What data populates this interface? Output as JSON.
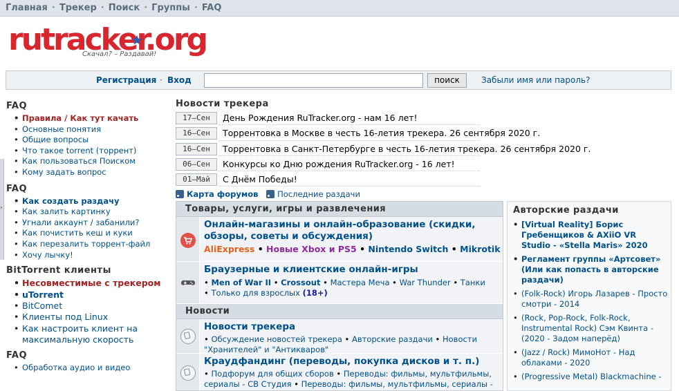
{
  "topnav": {
    "items": [
      "Главная",
      "Трекер",
      "Поиск",
      "Группы",
      "FAQ"
    ]
  },
  "logo": {
    "name": "rutracker.org",
    "slogan": "Скачал? – Раздавай!"
  },
  "login": {
    "register": "Регистрация",
    "login": "Вход",
    "search_value": "",
    "search_button": "поиск",
    "forgot": "Забыли имя или пароль?"
  },
  "left": {
    "sec1": {
      "title": "FAQ",
      "items": [
        "Правила",
        "Как тут качать",
        "Основные понятия",
        "Общие вопросы",
        "Что такое torrent (торрент)",
        "Как пользоваться Поиском",
        "Кому задать вопрос"
      ]
    },
    "sec2": {
      "title": "FAQ",
      "items": [
        "Как создать раздачу",
        "Как залить картинку",
        "Угнали аккаунт / забанили?",
        "Как почистить кеш и куки",
        "Как перезалить торрент-файл",
        "Хочу лычку!"
      ]
    },
    "sec3": {
      "title": "BitTorrent клиенты",
      "items": [
        "Несовместимые с трекером",
        "uTorrent",
        "BitComet",
        "Клиенты под Linux",
        "Как настроить клиент на максимальную скорость"
      ]
    },
    "sec4": {
      "title": "FAQ",
      "items": [
        "Обработка аудио и видео"
      ]
    }
  },
  "news": {
    "title": "Новости трекера",
    "items": [
      {
        "date": "17–Сен",
        "text": "День Рождения RuTracker.org - нам 16 лет!"
      },
      {
        "date": "16–Сен",
        "text": "Торрентовка в Москве в честь 16-летия трекера. 26 сентября 2020 г."
      },
      {
        "date": "16–Сен",
        "text": "Торрентовка в Санкт-Петербурге в честь 16-летия трекера. 26 сентября 2020 г."
      },
      {
        "date": "06–Сен",
        "text": "Конкурсы ко Дню рождения RuTracker.org - 16 лет!"
      },
      {
        "date": "01–Май",
        "text": "С Днём Победы!"
      }
    ]
  },
  "feeds": {
    "map": "Карта форумов",
    "latest": "Последние раздачи"
  },
  "forums": {
    "cat1": {
      "title": "Товары, услуги, игры и развлечения",
      "f1": {
        "title": "Онлайн-магазины и онлайн-образование (скидки, обзоры, советы и обсуждения)",
        "sub": [
          "AliExpress",
          "Новые Xbox и PS5",
          "Nintendo Switch",
          "Mikrotik"
        ]
      },
      "f2": {
        "title": "Браузерные и клиентские онлайн-игры",
        "sub": [
          "Men of War II",
          "Crossout",
          "Мастера Меча",
          "War Thunder",
          "Танки",
          "Только для взрослых",
          "(18+)"
        ]
      }
    },
    "cat2": {
      "title": "Новости",
      "f1": {
        "title": "Новости трекера",
        "sub": [
          "Обсуждение новостей трекера",
          "Авторские раздачи",
          "Новости \"Хранителей\" и \"Антикваров\""
        ]
      },
      "f2": {
        "title": "Краудфандинг (переводы, покупка дисков и т. п.)",
        "sub": [
          "Подфорум для общих сборов",
          "Переводы: фильмы, мультфильмы, сериалы - СВ Студия",
          "Переводы: фильмы, мультфильмы, сериалы -"
        ]
      }
    }
  },
  "authors": {
    "title": "Авторские раздачи",
    "items": [
      "[Virtual Reality] Борис Гребенщиков & AXiiO VR Studio - «Stella Maris» 2020",
      "Регламент группы «Артсовет» (Или как попасть в авторские раздачи)",
      "(Folk-Rock) Игорь Лазарев - Просто смотри - 2014",
      "(Rock, Pop-Rock, Folk-Rock, Instrumental Rock) Сэм Квинта - (2020 - Задом наперёд)",
      "(Jazz / Rock) МимоНот - Над облаками - 2020",
      "(Progressive Metal) Blackmachine -"
    ]
  },
  "colors": {
    "link": "#00508c",
    "red_link": "#a32222",
    "logo": "#d8262f",
    "header_bg": "#dfe4ea"
  }
}
